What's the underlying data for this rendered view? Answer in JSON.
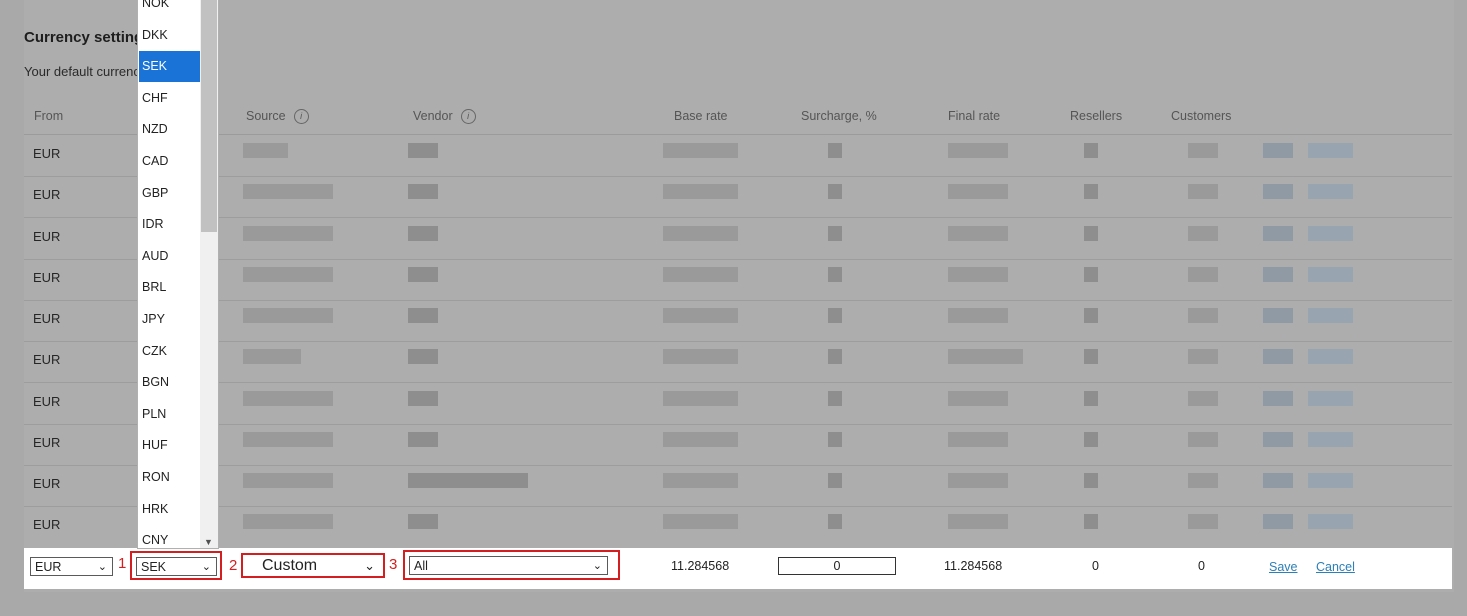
{
  "page": {
    "title": "Currency setting",
    "subtitle": "Your default currenc"
  },
  "table": {
    "headers": {
      "from": "From",
      "source": "Source",
      "vendor": "Vendor",
      "base_rate": "Base rate",
      "surcharge": "Surcharge, %",
      "final_rate": "Final rate",
      "resellers": "Resellers",
      "customers": "Customers"
    },
    "rows_from": [
      "EUR",
      "EUR",
      "EUR",
      "EUR",
      "EUR",
      "EUR",
      "EUR",
      "EUR",
      "EUR",
      "EUR"
    ]
  },
  "edit_row": {
    "from": "EUR",
    "to": "SEK",
    "source": "Custom",
    "vendor": "All",
    "base_rate": "11.284568",
    "surcharge": "0",
    "final_rate": "11.284568",
    "resellers": "0",
    "customers": "0",
    "save": "Save",
    "cancel": "Cancel",
    "markers": [
      "1",
      "2",
      "3"
    ]
  },
  "dropdown": {
    "options": [
      "NOK",
      "DKK",
      "SEK",
      "CHF",
      "NZD",
      "CAD",
      "GBP",
      "IDR",
      "AUD",
      "BRL",
      "JPY",
      "CZK",
      "BGN",
      "PLN",
      "HUF",
      "RON",
      "HRK",
      "CNY"
    ],
    "selected": "SEK"
  },
  "icons": {
    "info": "info-icon",
    "chevron": "chevron-down-icon"
  },
  "colors": {
    "highlight": "#d31f1f",
    "selected_option": "#1a73d6",
    "link": "#2c7fb8"
  }
}
